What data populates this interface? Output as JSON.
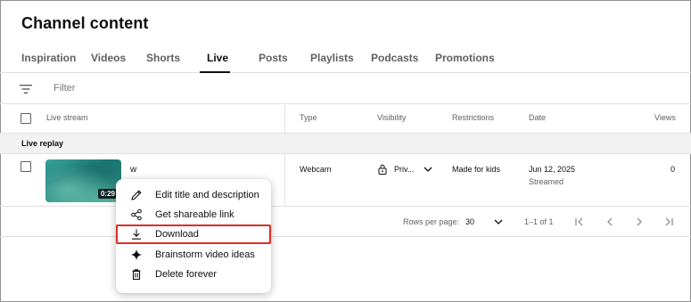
{
  "page_title": "Channel content",
  "tabs": [
    {
      "label": "Inspiration"
    },
    {
      "label": "Videos"
    },
    {
      "label": "Shorts"
    },
    {
      "label": "Live",
      "active": true
    },
    {
      "label": "Posts"
    },
    {
      "label": "Playlists"
    },
    {
      "label": "Podcasts"
    },
    {
      "label": "Promotions"
    }
  ],
  "filter": {
    "placeholder": "Filter"
  },
  "table": {
    "columns": {
      "live_stream": "Live stream",
      "type": "Type",
      "visibility": "Visibility",
      "restrictions": "Restrictions",
      "date": "Date",
      "views": "Views"
    },
    "section_label": "Live replay",
    "rows": [
      {
        "title": "w",
        "duration": "0:29",
        "type": "Webcam",
        "visibility": "Priv...",
        "restrictions": "Made for kids",
        "date": "Jun 12, 2025",
        "date_sub": "Streamed",
        "views": "0"
      }
    ]
  },
  "pager": {
    "rows_per_page_label": "Rows per page:",
    "rows_per_page_value": "30",
    "range": "1–1 of 1"
  },
  "context_menu": {
    "items": [
      {
        "label": "Edit title and description",
        "icon": "pencil-icon"
      },
      {
        "label": "Get shareable link",
        "icon": "share-icon"
      },
      {
        "label": "Download",
        "icon": "download-icon",
        "highlighted": true
      },
      {
        "label": "Brainstorm video ideas",
        "icon": "sparkle-icon"
      },
      {
        "label": "Delete forever",
        "icon": "trash-icon"
      }
    ]
  },
  "colors": {
    "highlight_border": "#d93025",
    "text_primary": "#0f0f0f",
    "text_secondary": "#606060",
    "divider": "#e0e0e0"
  }
}
